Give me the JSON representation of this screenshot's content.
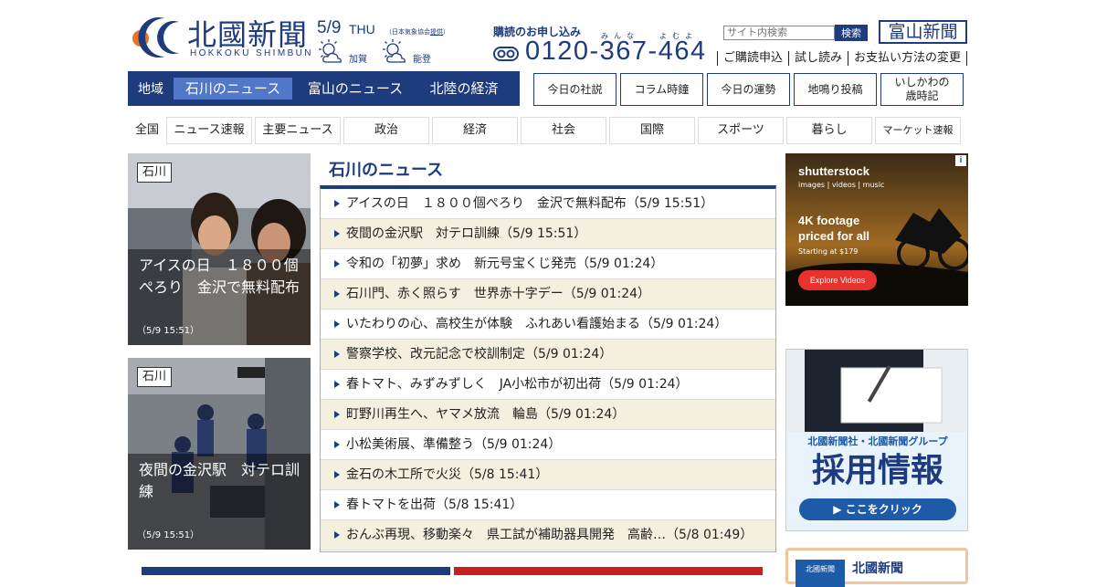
{
  "header": {
    "logo_kanji": "北國新聞",
    "logo_roman": "HOKKOKU SHIMBUN",
    "date": "5/9",
    "day": "THU",
    "weather_credit_pre": "（日本気象協会",
    "weather_credit_link": "提供",
    "weather_credit_post": "）",
    "weather": [
      {
        "area": "加賀",
        "icon": "sun-cloud-icon"
      },
      {
        "area": "能登",
        "icon": "sun-cloud-icon"
      }
    ],
    "subscribe_title": "購読のお申し込み",
    "ruby_minna": "みんな",
    "ruby_yomu": "よむよ",
    "phone": "0120-367-464",
    "search_placeholder": "サイト内検索",
    "search_button": "検索",
    "toyama_button": "富山新聞",
    "top_links": [
      "ご購読申込",
      "試し読み",
      "お支払い方法の変更"
    ]
  },
  "region_nav": {
    "label": "地域",
    "tabs": [
      "石川のニュース",
      "富山のニュース",
      "北陸の経済"
    ]
  },
  "utility_buttons": [
    "今日の社説",
    "コラム時鐘",
    "今日の運勢",
    "地鳴り投稿",
    "いしかわの\n歳時記"
  ],
  "category_nav": {
    "label": "全国",
    "items": [
      "ニュース速報",
      "主要ニュース",
      "政治",
      "経済",
      "社会",
      "国際",
      "スポーツ",
      "暮らし",
      "マーケット速報"
    ]
  },
  "cards": [
    {
      "tag": "石川",
      "caption": "アイスの日　１８００個ぺろり　金沢で無料配布",
      "time": "（5/9 15:51）"
    },
    {
      "tag": "石川",
      "caption": "夜間の金沢駅　対テロ訓練",
      "time": "（5/9 15:51）"
    }
  ],
  "news": {
    "title": "石川のニュース",
    "items": [
      "アイスの日　１８００個ぺろり　金沢で無料配布（5/9 15:51）",
      "夜間の金沢駅　対テロ訓練（5/9 15:51）",
      "令和の「初夢」求め　新元号宝くじ発売（5/9 01:24）",
      "石川門、赤く照らす　世界赤十字デー（5/9 01:24）",
      "いたわりの心、高校生が体験　ふれあい看護始まる（5/9 01:24）",
      "警察学校、改元記念で校訓制定（5/9 01:24）",
      "春トマト、みずみずしく　JA小松市が初出荷（5/9 01:24）",
      "町野川再生へ、ヤマメ放流　輪島（5/9 01:24）",
      "小松美術展、準備整う（5/9 01:24）",
      "金石の木工所で火災（5/8 15:41）",
      "春トマトを出荷（5/8 15:41）",
      "おんぶ再現、移動楽々　県工試が補助器具開発　高齢…（5/8 01:49）"
    ]
  },
  "ads": {
    "shutterstock": {
      "brand": "shutterstock",
      "sub": "images | videos | music",
      "headline1": "4K footage",
      "headline2": "priced for all",
      "price": "Starting at $179",
      "cta": "Explore Videos"
    },
    "recruit": {
      "company": "北國新聞社・北國新聞グループ",
      "headline": "採用情報",
      "cta": "▶ ここをクリック"
    },
    "bottom": {
      "label": "北國新聞",
      "logo_text": "北國新聞"
    }
  },
  "colors": {
    "brand_navy": "#1d3b7d",
    "active_tab": "#5077c8",
    "row_alt": "#f3f0df"
  }
}
